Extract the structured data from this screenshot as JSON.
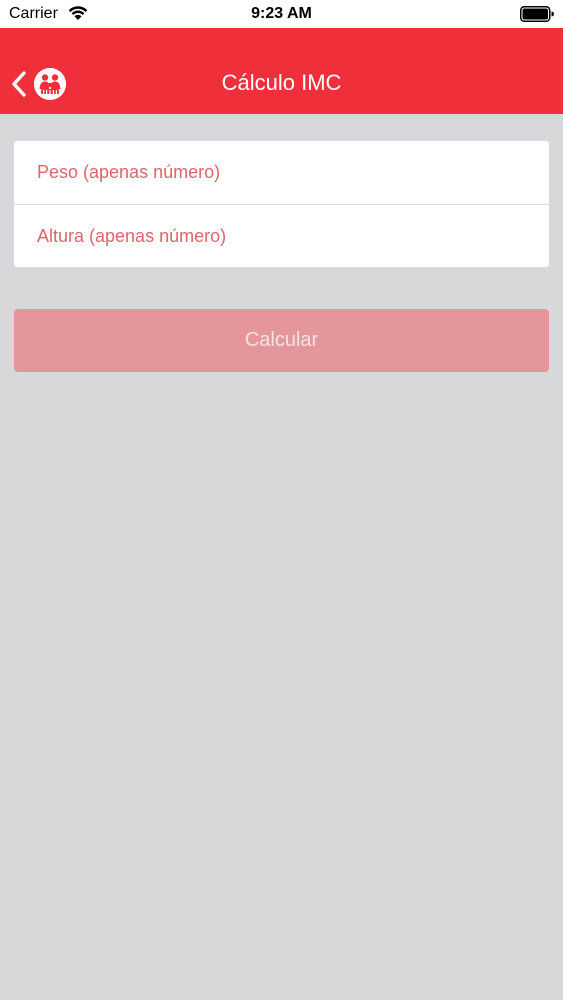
{
  "status_bar": {
    "carrier": "Carrier",
    "time": "9:23 AM",
    "wifi_icon": "wifi-icon",
    "battery_icon": "battery-icon"
  },
  "nav": {
    "title": "Cálculo IMC",
    "back_icon": "chevron-left-icon",
    "logo_icon": "family-logo-icon",
    "bar_color": "#ef303a"
  },
  "form": {
    "peso_placeholder": "Peso (apenas número)",
    "peso_value": "",
    "altura_placeholder": "Altura (apenas número)",
    "altura_value": ""
  },
  "actions": {
    "calculate_label": "Calcular",
    "button_color": "#e4969b"
  },
  "colors": {
    "background": "#d8d7da",
    "placeholder": "#e0646b"
  }
}
